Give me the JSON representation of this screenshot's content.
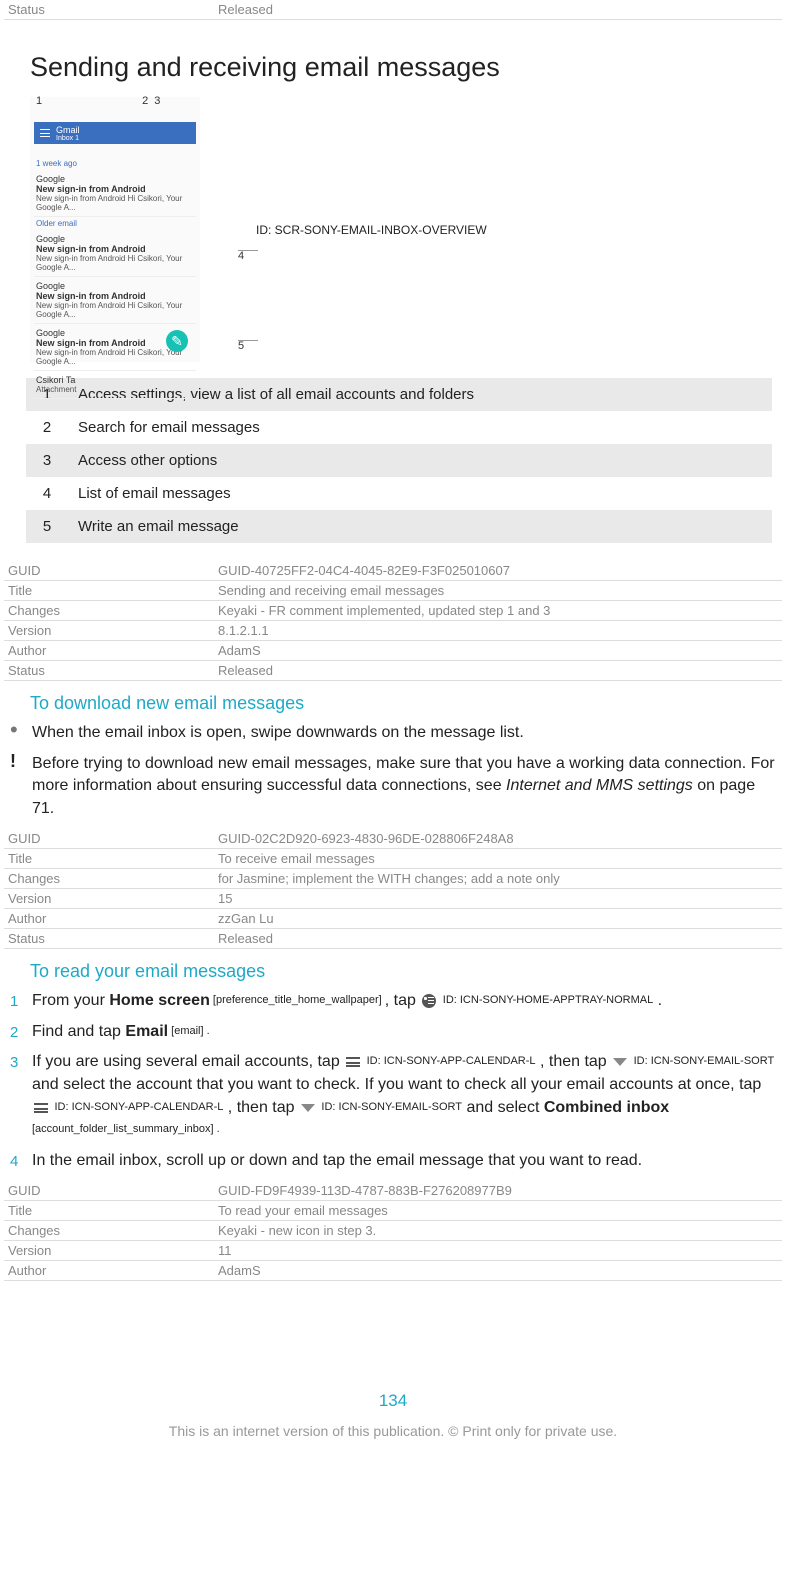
{
  "top_meta": {
    "status_label": "Status",
    "status_value": "Released"
  },
  "heading": "Sending and receiving email messages",
  "image_id_label": "ID: SCR-SONY-EMAIL-INBOX-OVERVIEW",
  "screenshot": {
    "num1": "1",
    "num2": "2",
    "num3": "3",
    "num4": "4",
    "num5": "5",
    "gmail": "Gmail",
    "inbox": "Inbox 1",
    "week": "1 week ago",
    "from": "Google",
    "subj": "New sign-in from Android",
    "snip": "New sign-in from Android Hi Csikori, Your Google A...",
    "older": "Older email",
    "att_from": "Csikori Ta",
    "att": "Attachment"
  },
  "legend": [
    {
      "n": "1",
      "t": "Access settings, view a list of all email accounts and folders"
    },
    {
      "n": "2",
      "t": "Search for email messages"
    },
    {
      "n": "3",
      "t": "Access other options"
    },
    {
      "n": "4",
      "t": "List of email messages"
    },
    {
      "n": "5",
      "t": "Write an email message"
    }
  ],
  "meta_block1": {
    "guid": "GUID-40725FF2-04C4-4045-82E9-F3F025010607",
    "title": "Sending and receiving email messages",
    "changes": "Keyaki - FR comment implemented, updated step 1 and 3",
    "version": "8.1.2.1.1",
    "author": "AdamS",
    "status": "Released"
  },
  "section_download": {
    "heading": "To download new email messages",
    "bullet": "When the email inbox is open, swipe downwards on the message list.",
    "note_pre": "Before trying to download new email messages, make sure that you have a working data connection. For more information about ensuring successful data connections, see ",
    "note_ital": "Internet and MMS settings",
    "note_post": " on page 71."
  },
  "meta_block2": {
    "guid": "GUID-02C2D920-6923-4830-96DE-028806F248A8",
    "title": "To receive email messages",
    "changes": "for Jasmine; implement the WITH changes; add a note only",
    "version": "15",
    "author": "zzGan Lu",
    "status": "Released"
  },
  "section_read": {
    "heading": "To read your email messages",
    "step1_a": "From your ",
    "step1_b": "Home screen",
    "step1_c": " [preference_title_home_wallpaper] ",
    "step1_d": ", tap ",
    "step1_icon1_id": "ID: ICN-SONY-HOME-APPTRAY-NORMAL",
    "step1_e": " .",
    "step2_a": "Find and tap ",
    "step2_b": "Email",
    "step2_c": " [email] .",
    "step3_a": "If you are using several email accounts, tap ",
    "step3_icon1_id": "ID: ICN-SONY-APP-CALENDAR-L",
    "step3_b": " , then tap ",
    "step3_icon2_id": "ID: ICN-SONY-EMAIL-SORT",
    "step3_c": " and select the account that you want to check. If you want to check all your email accounts at once, tap ",
    "step3_icon3_id": "ID: ICN-SONY-APP-CALENDAR-L",
    "step3_d": " , then tap ",
    "step3_icon4_id": "ID: ICN-SONY-EMAIL-SORT",
    "step3_e": " and select ",
    "step3_f": "Combined inbox",
    "step3_g": " [account_folder_list_summary_inbox] .",
    "step4": "In the email inbox, scroll up or down and tap the email message that you want to read."
  },
  "meta_block3": {
    "guid": "GUID-FD9F4939-113D-4787-883B-F276208977B9",
    "title": "To read your email messages",
    "changes": "Keyaki - new icon in step 3.",
    "version": "11",
    "author": "AdamS"
  },
  "meta_labels": {
    "guid": "GUID",
    "title": "Title",
    "changes": "Changes",
    "version": "Version",
    "author": "Author",
    "status": "Status"
  },
  "steps": {
    "s1": "1",
    "s2": "2",
    "s3": "3",
    "s4": "4"
  },
  "page_num": "134",
  "footer": "This is an internet version of this publication. © Print only for private use."
}
